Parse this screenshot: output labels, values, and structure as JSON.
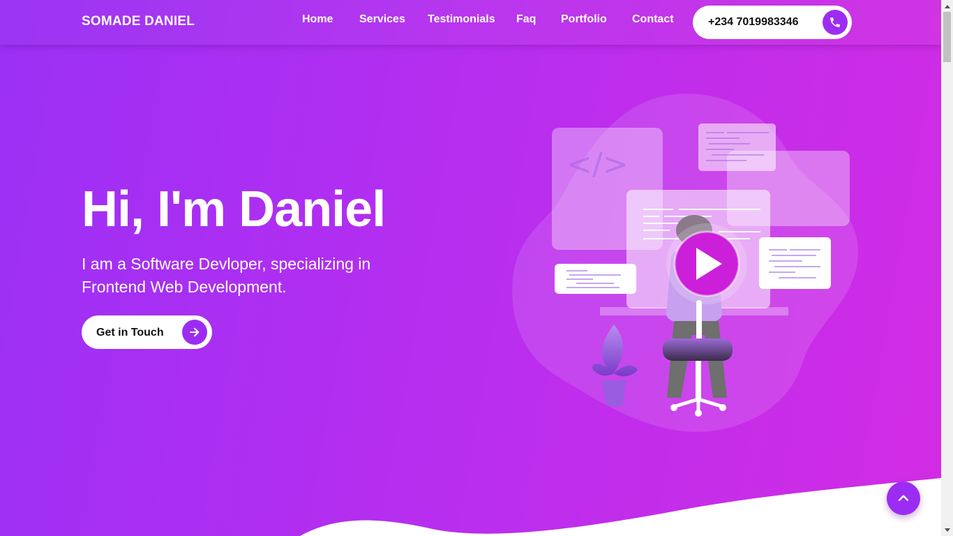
{
  "header": {
    "brand": "SOMADE DANIEL",
    "nav": [
      {
        "label": "Home"
      },
      {
        "label": "Services"
      },
      {
        "label": "Testimonials"
      },
      {
        "label": "Faq"
      },
      {
        "label": "Portfolio"
      },
      {
        "label": "Contact"
      }
    ],
    "phone": "+234 7019983346",
    "phone_icon": "phone-icon"
  },
  "hero": {
    "title": "Hi, I'm Daniel",
    "subtitle": "I am a Software Devloper, specializing in Frontend Web Development.",
    "cta_label": "Get in Touch",
    "cta_icon": "arrow-right-icon",
    "illustration_text": "</>"
  },
  "back_to_top_icon": "chevron-up-icon",
  "colors": {
    "accent": "#9d2cf3",
    "gradient_start": "#9b30f5",
    "gradient_end": "#d22ce4",
    "play_button": "#cc1fd9"
  }
}
